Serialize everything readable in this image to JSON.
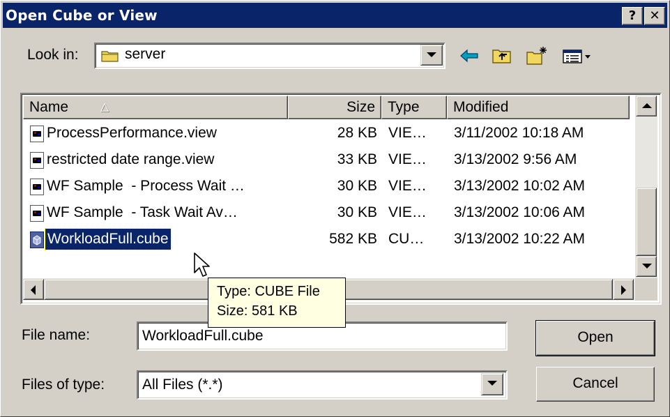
{
  "window": {
    "title": "Open Cube or View",
    "help_button": "?",
    "close_button": "✕"
  },
  "lookin": {
    "label": "Look in:",
    "value": "server",
    "icon": "folder-icon"
  },
  "toolbar": {
    "back_icon": "back-arrow-icon",
    "up_icon": "up-folder-icon",
    "new_folder_icon": "new-folder-icon",
    "view_menu_icon": "view-menu-icon"
  },
  "columns": {
    "name": "Name",
    "size": "Size",
    "type": "Type",
    "modified": "Modified"
  },
  "files": [
    {
      "name": "ProcessPerformance.view",
      "size": "28 KB",
      "type": "VIE…",
      "modified": "3/11/2002 10:18 AM",
      "icon": "view-file-icon"
    },
    {
      "name": "restricted date range.view",
      "size": "33 KB",
      "type": "VIE…",
      "modified": "3/13/2002 9:56 AM",
      "icon": "view-file-icon"
    },
    {
      "name": "WF Sample  - Process Wait …",
      "size": "30 KB",
      "type": "VIE…",
      "modified": "3/13/2002 10:02 AM",
      "icon": "view-file-icon"
    },
    {
      "name": "WF Sample  - Task Wait Av…",
      "size": "30 KB",
      "type": "VIE…",
      "modified": "3/13/2002 10:06 AM",
      "icon": "view-file-icon"
    },
    {
      "name": "WorkloadFull.cube",
      "size": "582 KB",
      "type": "CU…",
      "modified": "3/13/2002 10:22 AM",
      "icon": "cube-file-icon",
      "selected": true
    }
  ],
  "tooltip": {
    "line1": "Type: CUBE File",
    "line2": "Size: 581 KB"
  },
  "filename": {
    "label": "File name:",
    "value": "WorkloadFull.cube"
  },
  "filetype": {
    "label": "Files of type:",
    "value": "All Files (*.*)"
  },
  "buttons": {
    "open": "Open",
    "cancel": "Cancel"
  },
  "colors": {
    "titlebar": "#0a246a",
    "face": "#d4d0c8",
    "selection": "#0a246a",
    "tooltip": "#ffffe1"
  }
}
